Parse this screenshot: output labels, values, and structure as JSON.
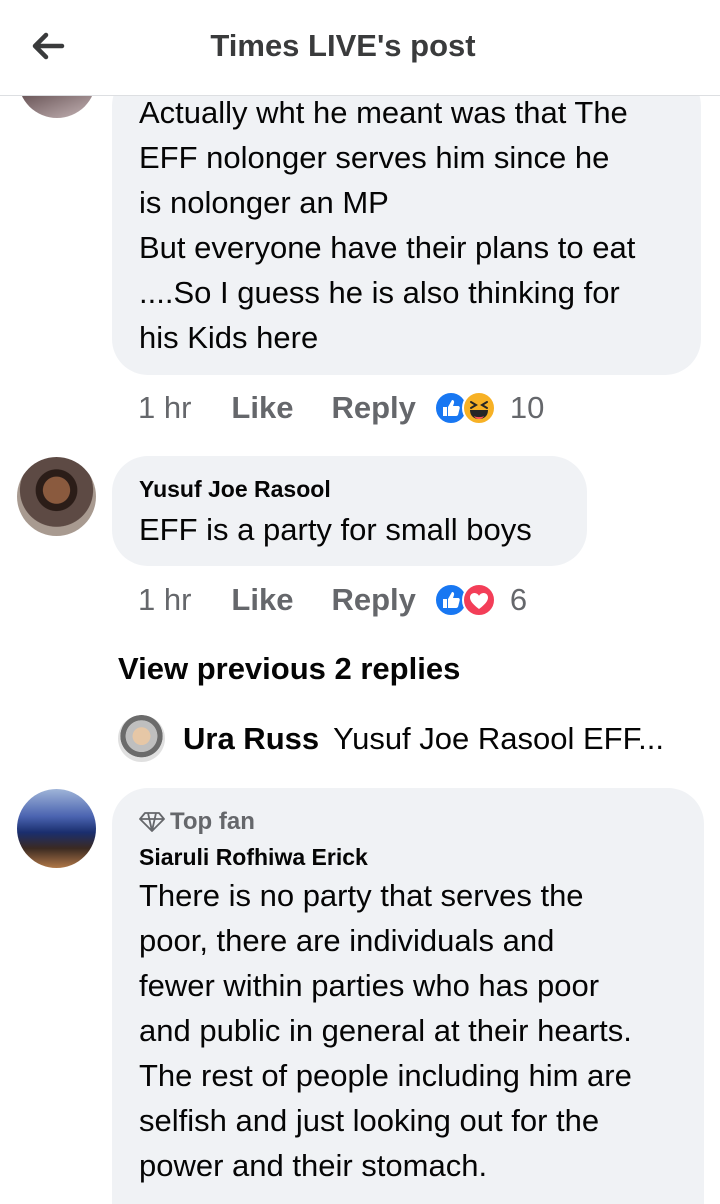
{
  "header": {
    "title": "Times LIVE's post"
  },
  "comments": [
    {
      "text_lines": [
        "Actually wht he meant was that The",
        "EFF nolonger serves him since he",
        "is nolonger an MP",
        "But everyone have their plans to eat",
        "....So I guess he is also thinking for",
        "his Kids here"
      ],
      "time": "1 hr",
      "like": "Like",
      "reply": "Reply",
      "reaction_icons": [
        "like-reaction-icon",
        "haha-reaction-icon"
      ],
      "reaction_count": "10"
    },
    {
      "author": "Yusuf Joe Rasool",
      "text": "EFF is a party for small boys",
      "time": "1 hr",
      "like": "Like",
      "reply": "Reply",
      "reaction_icons": [
        "like-reaction-icon",
        "love-reaction-icon"
      ],
      "reaction_count": "6"
    }
  ],
  "view_previous": "View previous 2 replies",
  "reply_preview": {
    "author": "Ura Russ",
    "snippet": "Yusuf Joe Rasool EFF..."
  },
  "comment3": {
    "badge": "Top fan",
    "author": "Siaruli Rofhiwa Erick",
    "text_lines": [
      "There is no party that serves the",
      "poor, there are individuals and",
      "fewer within parties who has poor",
      "and public in general at their hearts.",
      "The rest of people including him are",
      "selfish and just looking out for the",
      "power and their stomach."
    ]
  },
  "colors": {
    "like_blue": "#1877f2",
    "love_red": "#f33e58",
    "haha_yellow": "#f7b125",
    "bubble_gray": "#f0f2f5",
    "meta_gray": "#65676b"
  }
}
